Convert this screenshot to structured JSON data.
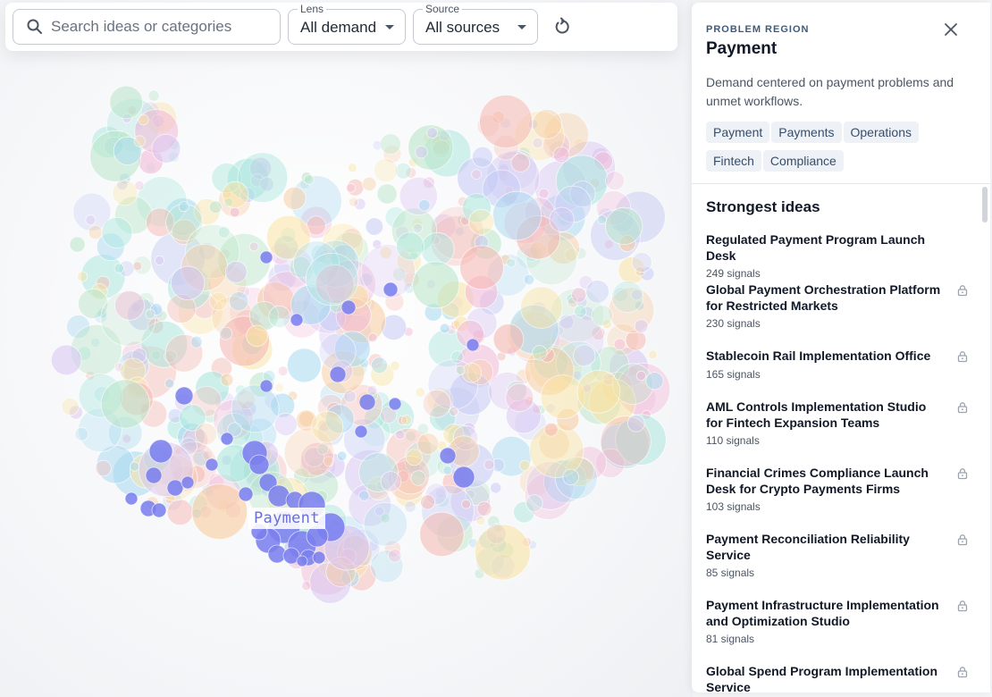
{
  "toolbar": {
    "search_placeholder": "Search ideas or categories",
    "lens": {
      "legend": "Lens",
      "value": "All demand"
    },
    "source": {
      "legend": "Source",
      "value": "All sources"
    }
  },
  "map": {
    "region_label": "Payment",
    "highlight_color": "#7b80ee"
  },
  "panel": {
    "eyebrow": "PROBLEM REGION",
    "title": "Payment",
    "description": "Demand centered on payment problems and unmet workflows.",
    "tags": [
      "Payment",
      "Payments",
      "Operations",
      "Fintech",
      "Compliance"
    ],
    "section_title": "Strongest ideas",
    "ideas": [
      {
        "title": "Regulated Payment Program Launch Desk",
        "signals": "249 signals",
        "locked": false
      },
      {
        "title": "Global Payment Orchestration Platform for Restricted Markets",
        "signals": "230 signals",
        "locked": true
      },
      {
        "title": "Stablecoin Rail Implementation Office",
        "signals": "165 signals",
        "locked": true
      },
      {
        "title": "AML Controls Implementation Studio for Fintech Expansion Teams",
        "signals": "110 signals",
        "locked": true
      },
      {
        "title": "Financial Crimes Compliance Launch Desk for Crypto Payments Firms",
        "signals": "103 signals",
        "locked": true
      },
      {
        "title": "Payment Reconciliation Reliability Service",
        "signals": "85 signals",
        "locked": true
      },
      {
        "title": "Payment Infrastructure Implementation and Optimization Studio",
        "signals": "81 signals",
        "locked": true
      },
      {
        "title": "Global Spend Program Implementation Service",
        "signals": "",
        "locked": true
      }
    ]
  }
}
